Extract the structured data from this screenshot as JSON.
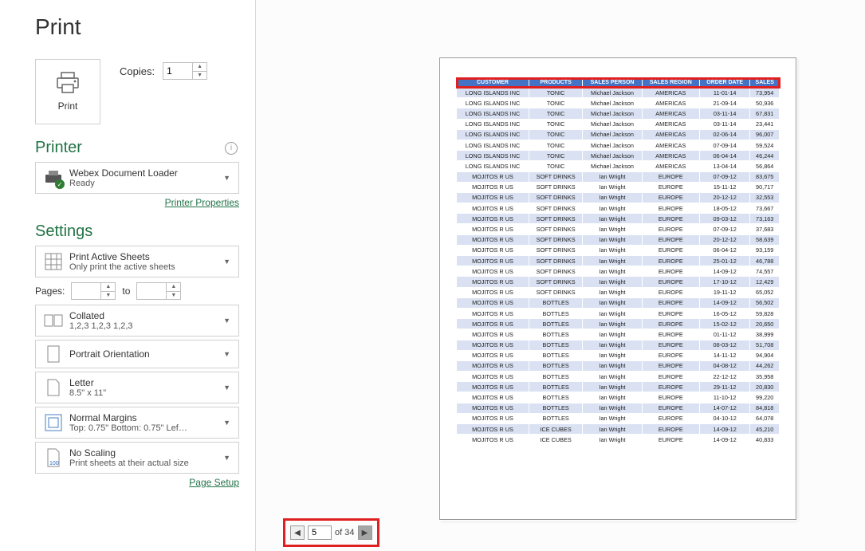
{
  "title": "Print",
  "print_button": "Print",
  "copies_label": "Copies:",
  "copies_value": "1",
  "printer_heading": "Printer",
  "printer": {
    "name": "Webex Document Loader",
    "status": "Ready"
  },
  "printer_props_link": "Printer Properties",
  "settings_heading": "Settings",
  "print_active": {
    "line1": "Print Active Sheets",
    "line2": "Only print the active sheets"
  },
  "pages_label": "Pages:",
  "pages_to": "to",
  "collated": {
    "line1": "Collated",
    "line2": "1,2,3    1,2,3    1,2,3"
  },
  "orientation": {
    "line1": "Portrait Orientation"
  },
  "paper": {
    "line1": "Letter",
    "line2": "8.5\" x 11\""
  },
  "margins": {
    "line1": "Normal Margins",
    "line2": "Top: 0.75\" Bottom: 0.75\" Lef…"
  },
  "scaling": {
    "line1": "No Scaling",
    "line2": "Print sheets at their actual size"
  },
  "page_setup_link": "Page Setup",
  "pager": {
    "current": "5",
    "of_label": "of",
    "total": "34"
  },
  "table": {
    "headers": [
      "CUSTOMER",
      "PRODUCTS",
      "SALES PERSON",
      "SALES REGION",
      "ORDER DATE",
      "SALES"
    ],
    "rows": [
      [
        "LONG ISLANDS INC",
        "TONIC",
        "Michael Jackson",
        "AMERICAS",
        "11-01-14",
        "73,954"
      ],
      [
        "LONG ISLANDS INC",
        "TONIC",
        "Michael Jackson",
        "AMERICAS",
        "21-09-14",
        "50,936"
      ],
      [
        "LONG ISLANDS INC",
        "TONIC",
        "Michael Jackson",
        "AMERICAS",
        "03-11-14",
        "67,831"
      ],
      [
        "LONG ISLANDS INC",
        "TONIC",
        "Michael Jackson",
        "AMERICAS",
        "03-11-14",
        "23,441"
      ],
      [
        "LONG ISLANDS INC",
        "TONIC",
        "Michael Jackson",
        "AMERICAS",
        "02-06-14",
        "96,007"
      ],
      [
        "LONG ISLANDS INC",
        "TONIC",
        "Michael Jackson",
        "AMERICAS",
        "07-09-14",
        "59,524"
      ],
      [
        "LONG ISLANDS INC",
        "TONIC",
        "Michael Jackson",
        "AMERICAS",
        "06-04-14",
        "46,244"
      ],
      [
        "LONG ISLANDS INC",
        "TONIC",
        "Michael Jackson",
        "AMERICAS",
        "13-04-14",
        "56,864"
      ],
      [
        "MOJITOS R US",
        "SOFT DRINKS",
        "Ian Wright",
        "EUROPE",
        "07-09-12",
        "83,675"
      ],
      [
        "MOJITOS R US",
        "SOFT DRINKS",
        "Ian Wright",
        "EUROPE",
        "15-11-12",
        "90,717"
      ],
      [
        "MOJITOS R US",
        "SOFT DRINKS",
        "Ian Wright",
        "EUROPE",
        "20-12-12",
        "32,553"
      ],
      [
        "MOJITOS R US",
        "SOFT DRINKS",
        "Ian Wright",
        "EUROPE",
        "18-05-12",
        "73,667"
      ],
      [
        "MOJITOS R US",
        "SOFT DRINKS",
        "Ian Wright",
        "EUROPE",
        "09-03-12",
        "73,163"
      ],
      [
        "MOJITOS R US",
        "SOFT DRINKS",
        "Ian Wright",
        "EUROPE",
        "07-09-12",
        "37,683"
      ],
      [
        "MOJITOS R US",
        "SOFT DRINKS",
        "Ian Wright",
        "EUROPE",
        "20-12-12",
        "58,639"
      ],
      [
        "MOJITOS R US",
        "SOFT DRINKS",
        "Ian Wright",
        "EUROPE",
        "06-04-12",
        "93,159"
      ],
      [
        "MOJITOS R US",
        "SOFT DRINKS",
        "Ian Wright",
        "EUROPE",
        "25-01-12",
        "46,788"
      ],
      [
        "MOJITOS R US",
        "SOFT DRINKS",
        "Ian Wright",
        "EUROPE",
        "14-09-12",
        "74,557"
      ],
      [
        "MOJITOS R US",
        "SOFT DRINKS",
        "Ian Wright",
        "EUROPE",
        "17-10-12",
        "12,429"
      ],
      [
        "MOJITOS R US",
        "SOFT DRINKS",
        "Ian Wright",
        "EUROPE",
        "19-11-12",
        "65,052"
      ],
      [
        "MOJITOS R US",
        "BOTTLES",
        "Ian Wright",
        "EUROPE",
        "14-09-12",
        "56,502"
      ],
      [
        "MOJITOS R US",
        "BOTTLES",
        "Ian Wright",
        "EUROPE",
        "16-05-12",
        "59,828"
      ],
      [
        "MOJITOS R US",
        "BOTTLES",
        "Ian Wright",
        "EUROPE",
        "15-02-12",
        "20,650"
      ],
      [
        "MOJITOS R US",
        "BOTTLES",
        "Ian Wright",
        "EUROPE",
        "01-11-12",
        "38,999"
      ],
      [
        "MOJITOS R US",
        "BOTTLES",
        "Ian Wright",
        "EUROPE",
        "08-03-12",
        "51,708"
      ],
      [
        "MOJITOS R US",
        "BOTTLES",
        "Ian Wright",
        "EUROPE",
        "14-11-12",
        "94,904"
      ],
      [
        "MOJITOS R US",
        "BOTTLES",
        "Ian Wright",
        "EUROPE",
        "04-08-12",
        "44,262"
      ],
      [
        "MOJITOS R US",
        "BOTTLES",
        "Ian Wright",
        "EUROPE",
        "22-12-12",
        "35,958"
      ],
      [
        "MOJITOS R US",
        "BOTTLES",
        "Ian Wright",
        "EUROPE",
        "29-11-12",
        "20,830"
      ],
      [
        "MOJITOS R US",
        "BOTTLES",
        "Ian Wright",
        "EUROPE",
        "11-10-12",
        "99,220"
      ],
      [
        "MOJITOS R US",
        "BOTTLES",
        "Ian Wright",
        "EUROPE",
        "14-07-12",
        "84,818"
      ],
      [
        "MOJITOS R US",
        "BOTTLES",
        "Ian Wright",
        "EUROPE",
        "04-10-12",
        "64,078"
      ],
      [
        "MOJITOS R US",
        "ICE CUBES",
        "Ian Wright",
        "EUROPE",
        "14-09-12",
        "45,210"
      ],
      [
        "MOJITOS R US",
        "ICE CUBES",
        "Ian Wright",
        "EUROPE",
        "14-09-12",
        "40,833"
      ]
    ]
  }
}
